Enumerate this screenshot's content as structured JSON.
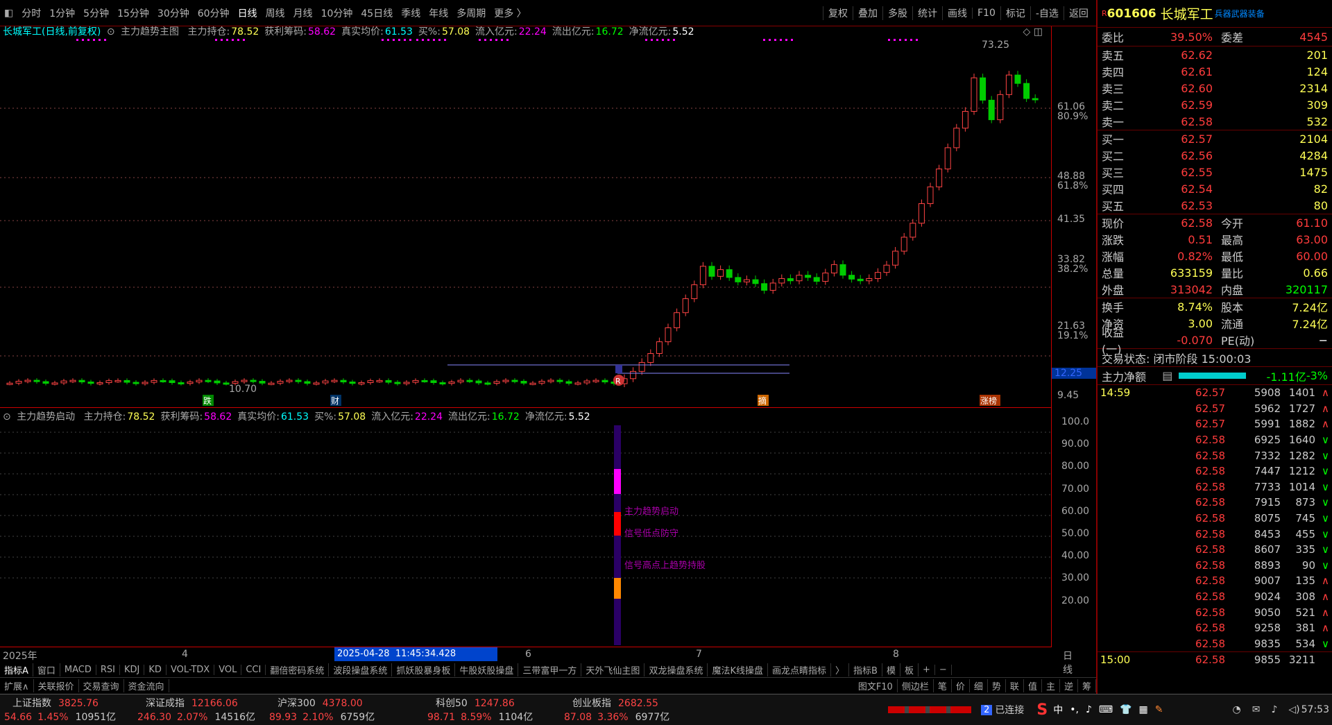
{
  "toolbar": {
    "periods": [
      "分时",
      "1分钟",
      "5分钟",
      "15分钟",
      "30分钟",
      "60分钟",
      "日线",
      "周线",
      "月线",
      "10分钟",
      "45日线",
      "季线",
      "年线",
      "多周期",
      "更多 〉"
    ],
    "active_period": "日线",
    "right_buttons": [
      "复权",
      "叠加",
      "多股",
      "统计",
      "画线",
      "F10",
      "标记",
      "-自选",
      "返回"
    ]
  },
  "main": {
    "title": "长城军工(日线,前复权)",
    "indicator": "主力趋势主图",
    "items": [
      {
        "label": "主力持仓:",
        "value": "78.52",
        "color": "#ff5"
      },
      {
        "label": "获利筹码:",
        "value": "58.62",
        "color": "#f0f"
      },
      {
        "label": "真实均价:",
        "value": "61.53",
        "color": "#0ff"
      },
      {
        "label": "买%:",
        "value": "57.08",
        "color": "#ff5"
      },
      {
        "label": "流入亿元:",
        "value": "22.24",
        "color": "#f0f"
      },
      {
        "label": "流出亿元:",
        "value": "16.72",
        "color": "#0f0"
      },
      {
        "label": "净流亿元:",
        "value": "5.52",
        "color": "#fff"
      }
    ],
    "high_label": "73.25",
    "low_label": "10.70",
    "markers": [
      "跌",
      "财",
      "摘",
      "涨榜"
    ],
    "flag": "R"
  },
  "axis_main": [
    {
      "price": "61.06",
      "pct": "80.9%"
    },
    {
      "price": "48.88",
      "pct": "61.8%"
    },
    {
      "price": "41.35",
      "pct": ""
    },
    {
      "price": "33.82",
      "pct": "38.2%"
    },
    {
      "price": "21.63",
      "pct": "19.1%"
    },
    {
      "price": "9.45",
      "pct": ""
    }
  ],
  "axis_current": "12.25",
  "sub": {
    "title": "主力趋势启动",
    "items": [
      {
        "label": "主力持仓:",
        "value": "78.52",
        "color": "#ff5"
      },
      {
        "label": "获利筹码:",
        "value": "58.62",
        "color": "#f0f"
      },
      {
        "label": "真实均价:",
        "value": "61.53",
        "color": "#0ff"
      },
      {
        "label": "买%:",
        "value": "57.08",
        "color": "#ff5"
      },
      {
        "label": "流入亿元:",
        "value": "22.24",
        "color": "#f0f"
      },
      {
        "label": "流出亿元:",
        "value": "16.72",
        "color": "#0f0"
      },
      {
        "label": "净流亿元:",
        "value": "5.52",
        "color": "#fff"
      }
    ],
    "annotations": [
      "主力趋势启动",
      "信号低点防守",
      "信号高点上趋势持股"
    ],
    "axis": [
      "100.0",
      "90.00",
      "80.00",
      "70.00",
      "60.00",
      "50.00",
      "40.00",
      "30.00",
      "20.00"
    ]
  },
  "dates": {
    "year": "2025年",
    "m4": "4",
    "sel1": "2025-04-28",
    "sel2": "11:45:34.428",
    "m6": "6",
    "m7": "7",
    "m8": "8",
    "period": "日线"
  },
  "tabs1": [
    "指标A",
    "窗口",
    "MACD",
    "RSI",
    "KDJ",
    "KD",
    "VOL-TDX",
    "VOL",
    "CCI",
    "翻倍密码系统",
    "波段操盘系统",
    "抓妖股暴身板",
    "牛股妖股操盘",
    "三带富甲一方",
    "天外飞仙主图",
    "双龙操盘系统",
    "魔法K线操盘",
    "画龙点睛指标",
    "〉",
    "指标B",
    "模",
    "板",
    "+",
    "−"
  ],
  "tabs2": [
    "扩展∧",
    "关联报价",
    "交易查询",
    "资金流向",
    "图文F10",
    "侧边栏",
    "笔",
    "价",
    "细",
    "势",
    "联",
    "值",
    "主",
    "逆",
    "筹"
  ],
  "panel": {
    "code": "601606",
    "name": "长城军工",
    "hot": "兵器武器装备",
    "badge": "R",
    "wb": {
      "label": "委比",
      "value": "39.50%",
      "label2": "委差",
      "value2": "4545"
    },
    "sells": [
      {
        "l": "卖五",
        "p": "62.62",
        "v": "201"
      },
      {
        "l": "卖四",
        "p": "62.61",
        "v": "124"
      },
      {
        "l": "卖三",
        "p": "62.60",
        "v": "2314"
      },
      {
        "l": "卖二",
        "p": "62.59",
        "v": "309"
      },
      {
        "l": "卖一",
        "p": "62.58",
        "v": "532"
      }
    ],
    "buys": [
      {
        "l": "买一",
        "p": "62.57",
        "v": "2104"
      },
      {
        "l": "买二",
        "p": "62.56",
        "v": "4284"
      },
      {
        "l": "买三",
        "p": "62.55",
        "v": "1475"
      },
      {
        "l": "买四",
        "p": "62.54",
        "v": "82"
      },
      {
        "l": "买五",
        "p": "62.53",
        "v": "80"
      }
    ],
    "stats": [
      {
        "l": "现价",
        "v": "62.58",
        "l2": "今开",
        "v2": "61.10"
      },
      {
        "l": "涨跌",
        "v": "0.51",
        "l2": "最高",
        "v2": "63.00"
      },
      {
        "l": "涨幅",
        "v": "0.82%",
        "l2": "最低",
        "v2": "60.00"
      },
      {
        "l": "总量",
        "v": "633159",
        "l2": "量比",
        "v2": "0.66"
      },
      {
        "l": "外盘",
        "v": "313042",
        "l2": "内盘",
        "v2": "320117"
      }
    ],
    "stats2": [
      {
        "l": "换手",
        "v": "8.74%",
        "l2": "股本",
        "v2": "7.24亿"
      },
      {
        "l": "净资",
        "v": "3.00",
        "l2": "流通",
        "v2": "7.24亿"
      },
      {
        "l": "收益(一)",
        "v": "-0.070",
        "l2": "PE(动)",
        "v2": "−"
      }
    ],
    "trade_state": "交易状态: 闭市阶段 15:00:03",
    "net_label": "主力净额",
    "net_value": "-1.11亿",
    "net_pct": "-3%",
    "ticks": [
      {
        "t": "14:59",
        "p": "62.57",
        "v": "5908",
        "n": "1401",
        "d": "∧"
      },
      {
        "t": "",
        "p": "62.57",
        "v": "5962",
        "n": "1727",
        "d": "∧"
      },
      {
        "t": "",
        "p": "62.57",
        "v": "5991",
        "n": "1882",
        "d": "∧"
      },
      {
        "t": "",
        "p": "62.58",
        "v": "6925",
        "n": "1640",
        "d": "∨"
      },
      {
        "t": "",
        "p": "62.58",
        "v": "7332",
        "n": "1282",
        "d": "∨"
      },
      {
        "t": "",
        "p": "62.58",
        "v": "7447",
        "n": "1212",
        "d": "∨"
      },
      {
        "t": "",
        "p": "62.58",
        "v": "7733",
        "n": "1014",
        "d": "∨"
      },
      {
        "t": "",
        "p": "62.58",
        "v": "7915",
        "n": "873",
        "d": "∨"
      },
      {
        "t": "",
        "p": "62.58",
        "v": "8075",
        "n": "745",
        "d": "∨"
      },
      {
        "t": "",
        "p": "62.58",
        "v": "8453",
        "n": "455",
        "d": "∨"
      },
      {
        "t": "",
        "p": "62.58",
        "v": "8607",
        "n": "335",
        "d": "∨"
      },
      {
        "t": "",
        "p": "62.58",
        "v": "8893",
        "n": "90",
        "d": "∨"
      },
      {
        "t": "",
        "p": "62.58",
        "v": "9007",
        "n": "135",
        "d": "∧"
      },
      {
        "t": "",
        "p": "62.58",
        "v": "9024",
        "n": "308",
        "d": "∧"
      },
      {
        "t": "",
        "p": "62.58",
        "v": "9050",
        "n": "521",
        "d": "∧"
      },
      {
        "t": "",
        "p": "62.58",
        "v": "9258",
        "n": "381",
        "d": "∧"
      },
      {
        "t": "",
        "p": "62.58",
        "v": "9835",
        "n": "534",
        "d": "∨"
      }
    ],
    "last_tick": {
      "t": "15:00",
      "p": "62.58",
      "v": "9855",
      "n": "3211"
    }
  },
  "indices": [
    {
      "name": "上证指数",
      "val": "3825.76",
      "chg": "54.66",
      "pct": "1.45%",
      "amt": "10951亿"
    },
    {
      "name": "深证成指",
      "val": "12166.06",
      "chg": "246.30",
      "pct": "2.07%",
      "amt": "14516亿"
    },
    {
      "name": "沪深300",
      "val": "4378.00",
      "chg": "89.93",
      "pct": "2.10%",
      "amt": "6759亿"
    },
    {
      "name": "科创50",
      "val": "1247.86",
      "chg": "98.71",
      "pct": "8.59%",
      "amt": "1104亿"
    },
    {
      "name": "创业板指",
      "val": "2682.55",
      "chg": "87.08",
      "pct": "3.36%",
      "amt": "6977亿"
    }
  ],
  "status": {
    "connect_num": "2",
    "connect": "已连接",
    "time": "57:53",
    "ime": "中"
  }
}
